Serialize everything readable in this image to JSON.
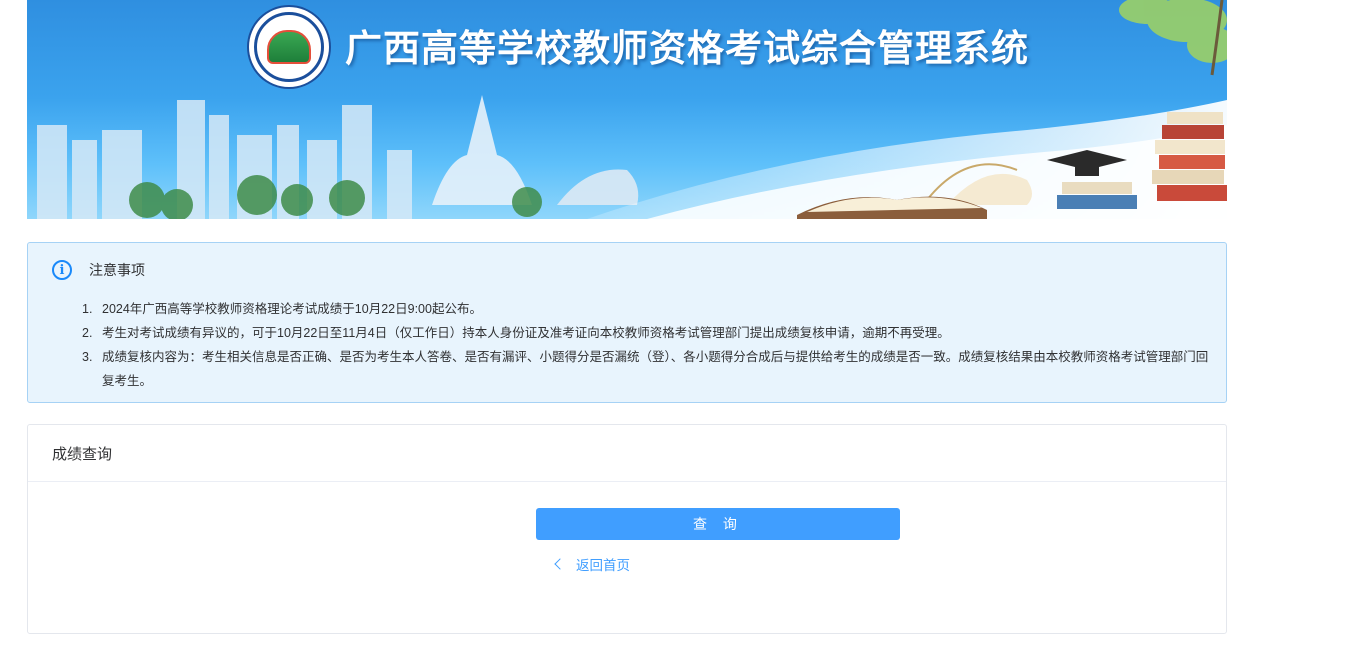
{
  "header": {
    "title": "广西高等学校教师资格考试综合管理系统",
    "logo_icon": "school-emblem-icon"
  },
  "notice": {
    "icon": "info-circle-icon",
    "title": "注意事项",
    "items": [
      {
        "num": "1.",
        "text": "2024年广西高等学校教师资格理论考试成绩于10月22日9:00起公布。"
      },
      {
        "num": "2.",
        "text": "考生对考试成绩有异议的，可于10月22日至11月4日（仅工作日）持本人身份证及准考证向本校教师资格考试管理部门提出成绩复核申请，逾期不再受理。"
      },
      {
        "num": "3.",
        "text": "成绩复核内容为：考生相关信息是否正确、是否为考生本人答卷、是否有漏评、小题得分是否漏统（登）、各小题得分合成后与提供给考生的成绩是否一致。成绩复核结果由本校教师资格考试管理部门回复考生。"
      }
    ]
  },
  "query": {
    "card_title": "成绩查询",
    "button_label": "查 询",
    "back_label": "返回首页",
    "back_icon": "chevron-left-icon"
  },
  "colors": {
    "primary": "#409eff",
    "notice_bg": "#e8f4fd",
    "notice_border": "#a6d2f5"
  }
}
